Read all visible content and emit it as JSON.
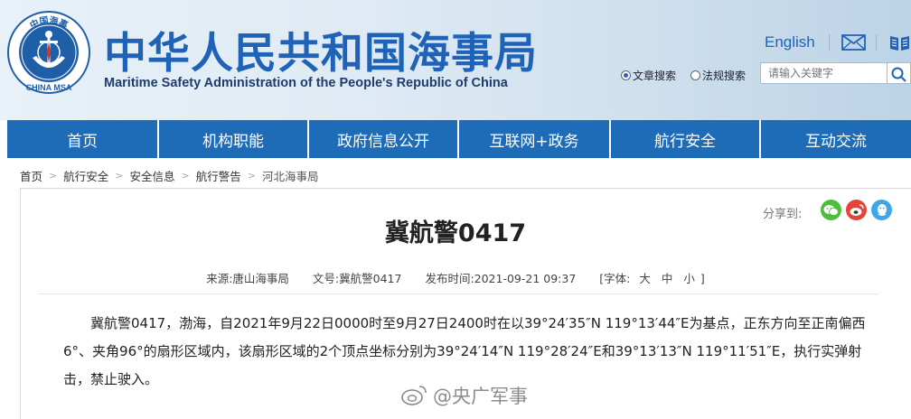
{
  "header": {
    "logo_text": "中国海事",
    "logo_subtext": "CHINA MSA",
    "title_cn": "中华人民共和国海事局",
    "title_en": "Maritime Safety Administration of the People's Republic of China",
    "english_link": "English",
    "search": {
      "option_article": "文章搜索",
      "option_regulation": "法规搜索",
      "placeholder": "请输入关键字"
    }
  },
  "nav": {
    "items": [
      {
        "label": "首页"
      },
      {
        "label": "机构职能"
      },
      {
        "label": "政府信息公开"
      },
      {
        "label": "互联网+政务"
      },
      {
        "label": "航行安全"
      },
      {
        "label": "互动交流"
      }
    ]
  },
  "breadcrumb": {
    "items": [
      "首页",
      "航行安全",
      "安全信息",
      "航行警告",
      "河北海事局"
    ]
  },
  "share": {
    "label": "分享到:"
  },
  "article": {
    "title": "冀航警0417",
    "source_label": "来源:",
    "source": "唐山海事局",
    "doc_no_label": "文号:",
    "doc_no": "冀航警0417",
    "publish_label": "发布时间:",
    "publish_time": "2021-09-21 09:37",
    "font_label": "[字体:",
    "font_large": "大",
    "font_medium": "中",
    "font_small": "小",
    "font_close": "]",
    "body": "冀航警0417，渤海，自2021年9月22日0000时至9月27日2400时在以39°24′35″N 119°13′44″E为基点，正东方向至正南偏西6°、夹角96°的扇形区域内，该扇形区域的2个顶点坐标分别为39°24′14″N 119°28′24″E和39°13′13″N 119°11′51″E，执行实弹射击，禁止驶入。"
  },
  "watermark": {
    "text": "@央广军事"
  },
  "colors": {
    "brand_blue": "#1f63b8",
    "nav_blue": "#1e6bb8",
    "wechat_green": "#4bbf3a",
    "weibo_red": "#e6443a",
    "qq_blue": "#3fa7e8"
  }
}
